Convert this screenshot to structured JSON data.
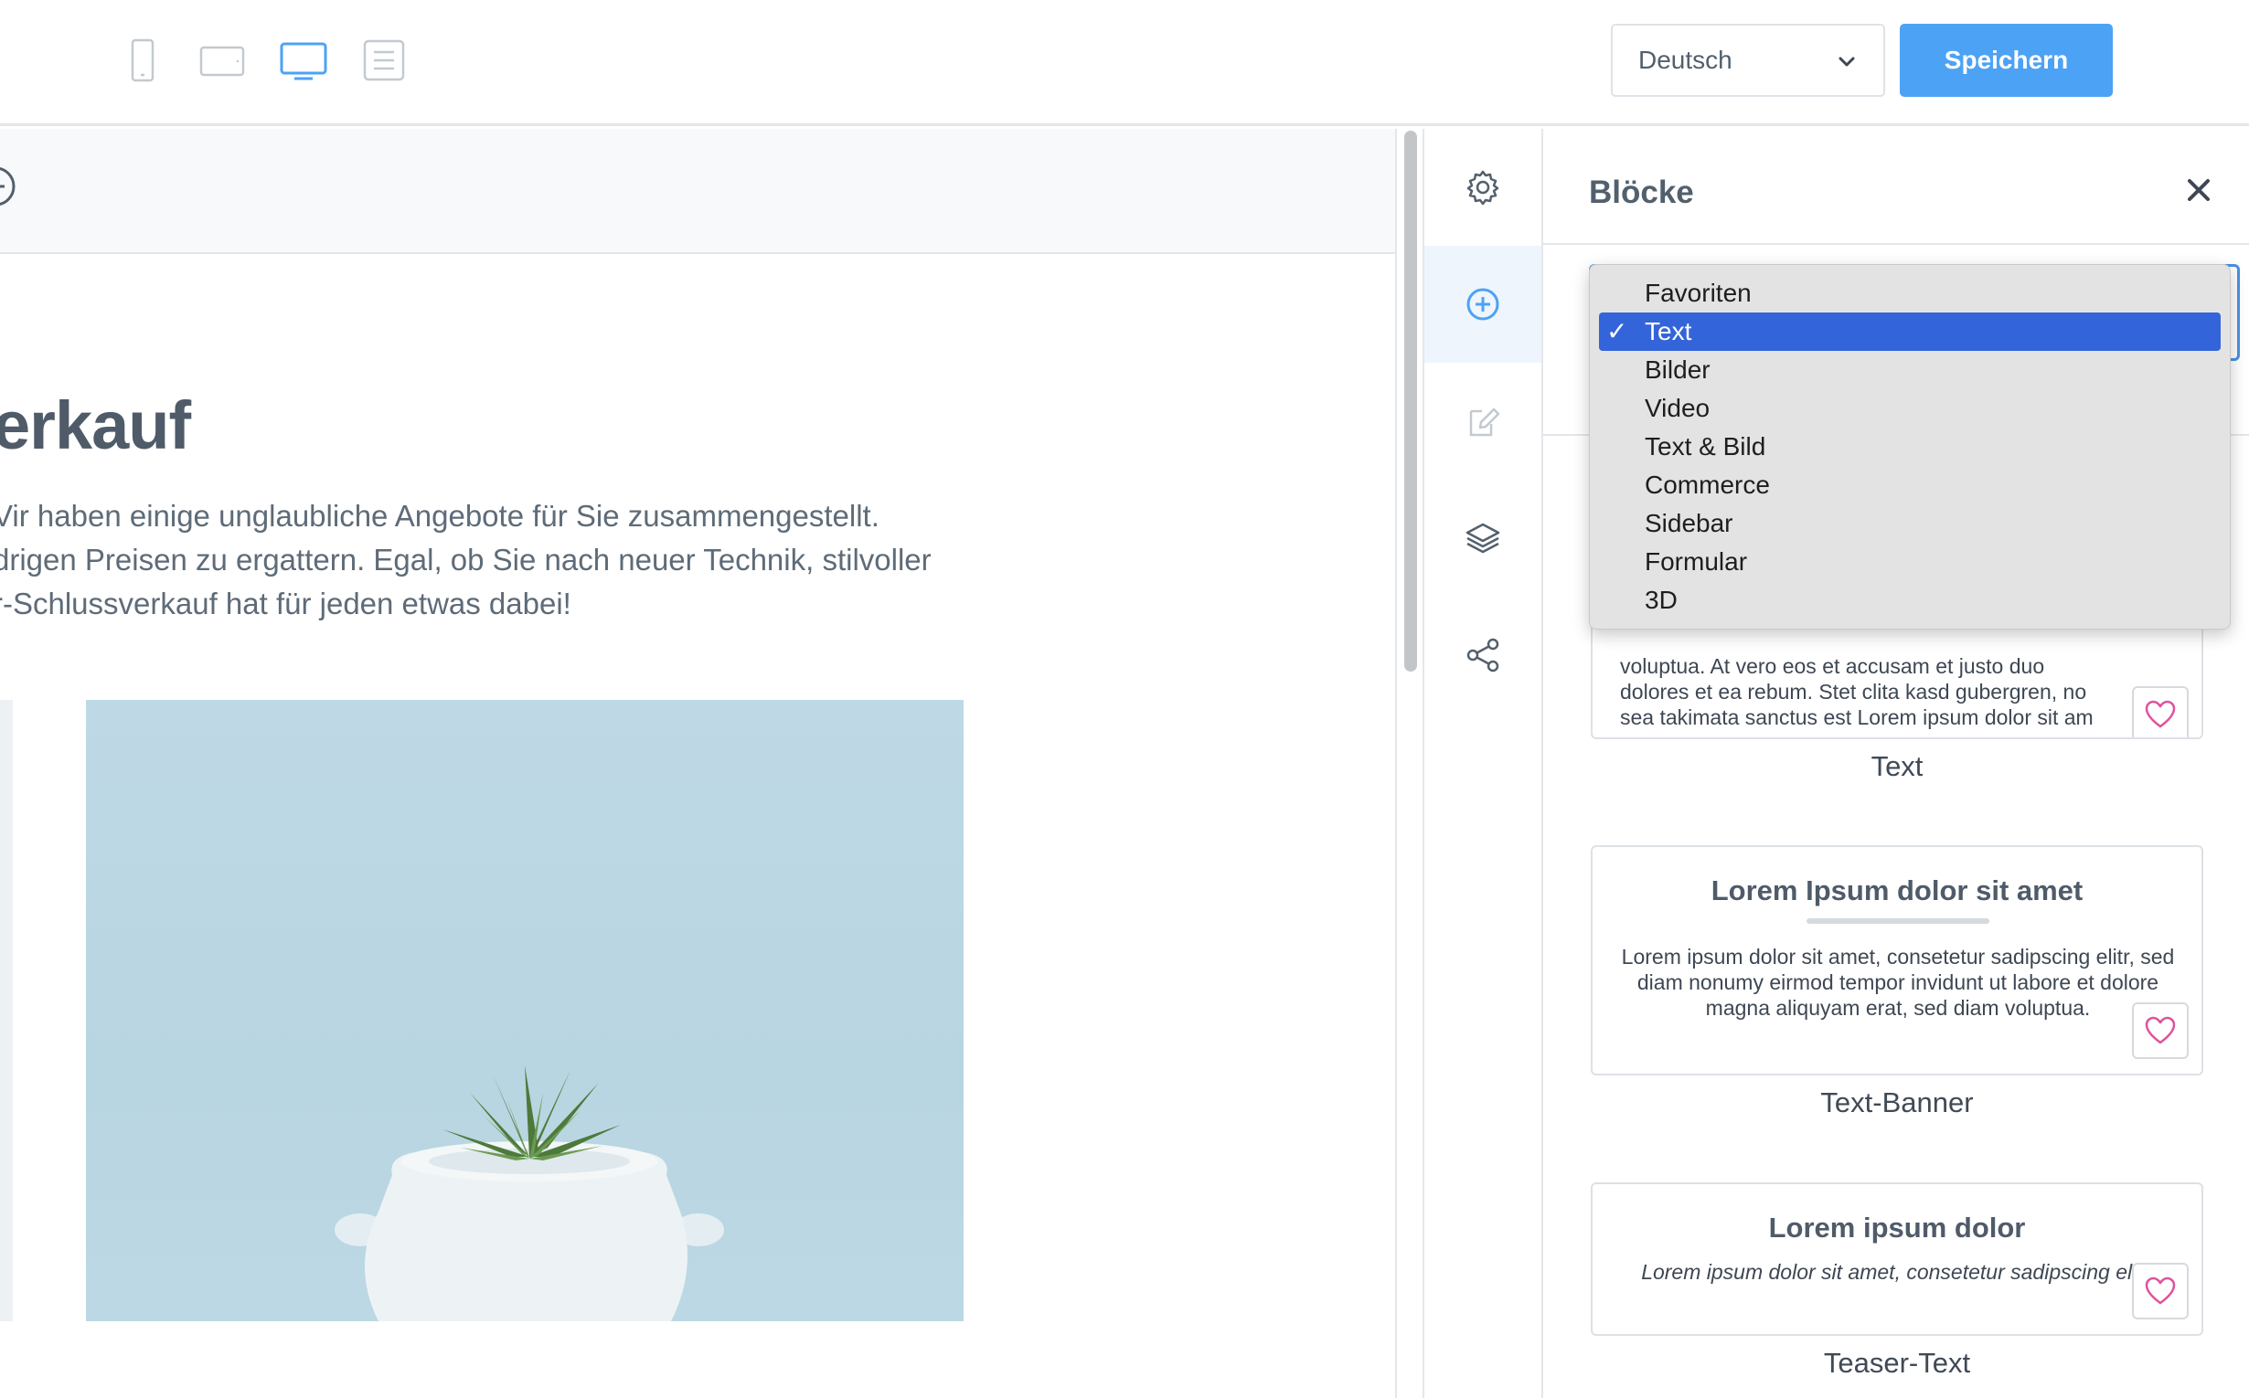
{
  "toolbar": {
    "devices": [
      {
        "name": "mobile",
        "active": false
      },
      {
        "name": "tablet",
        "active": false
      },
      {
        "name": "desktop",
        "active": true
      },
      {
        "name": "document",
        "active": false
      }
    ],
    "language": "Deutsch",
    "save_label": "Speichern"
  },
  "canvas": {
    "hero_title": "erkauf",
    "hero_lines": [
      "Vir haben einige unglaubliche Angebote für Sie zusammengestellt.",
      "drigen Preisen zu ergattern. Egal, ob Sie nach neuer Technik, stilvoller",
      "r-Schlussverkauf hat für jeden etwas dabei!"
    ]
  },
  "rail": {
    "items": [
      "gear-icon",
      "plus-circle-icon",
      "edit-icon",
      "layers-icon",
      "share-icon"
    ],
    "active_index": 1
  },
  "panel": {
    "title": "Blöcke",
    "category_options": [
      "Favoriten",
      "Text",
      "Bilder",
      "Video",
      "Text & Bild",
      "Commerce",
      "Sidebar",
      "Formular",
      "3D"
    ],
    "selected_category": "Text",
    "check_mark": "✓",
    "cards": [
      {
        "label": "Text",
        "body_lines": [
          "voluptua. At vero eos et accusam et justo duo",
          "dolores et ea rebum. Stet clita kasd gubergren, no",
          "sea takimata sanctus est Lorem ipsum dolor sit am"
        ]
      },
      {
        "label": "Text-Banner",
        "title": "Lorem Ipsum dolor sit amet",
        "body": "Lorem ipsum dolor sit amet, consetetur sadipscing elitr, sed diam nonumy eirmod tempor invidunt ut labore et dolore magna aliquyam erat, sed diam voluptua."
      },
      {
        "label": "Teaser-Text",
        "title": "Lorem ipsum dolor",
        "body": "Lorem ipsum dolor sit amet, consetetur sadipscing elitr."
      }
    ]
  },
  "colors": {
    "accent": "#4ca2f5",
    "selected_option": "#3464d9",
    "heart": "#e0529c"
  }
}
